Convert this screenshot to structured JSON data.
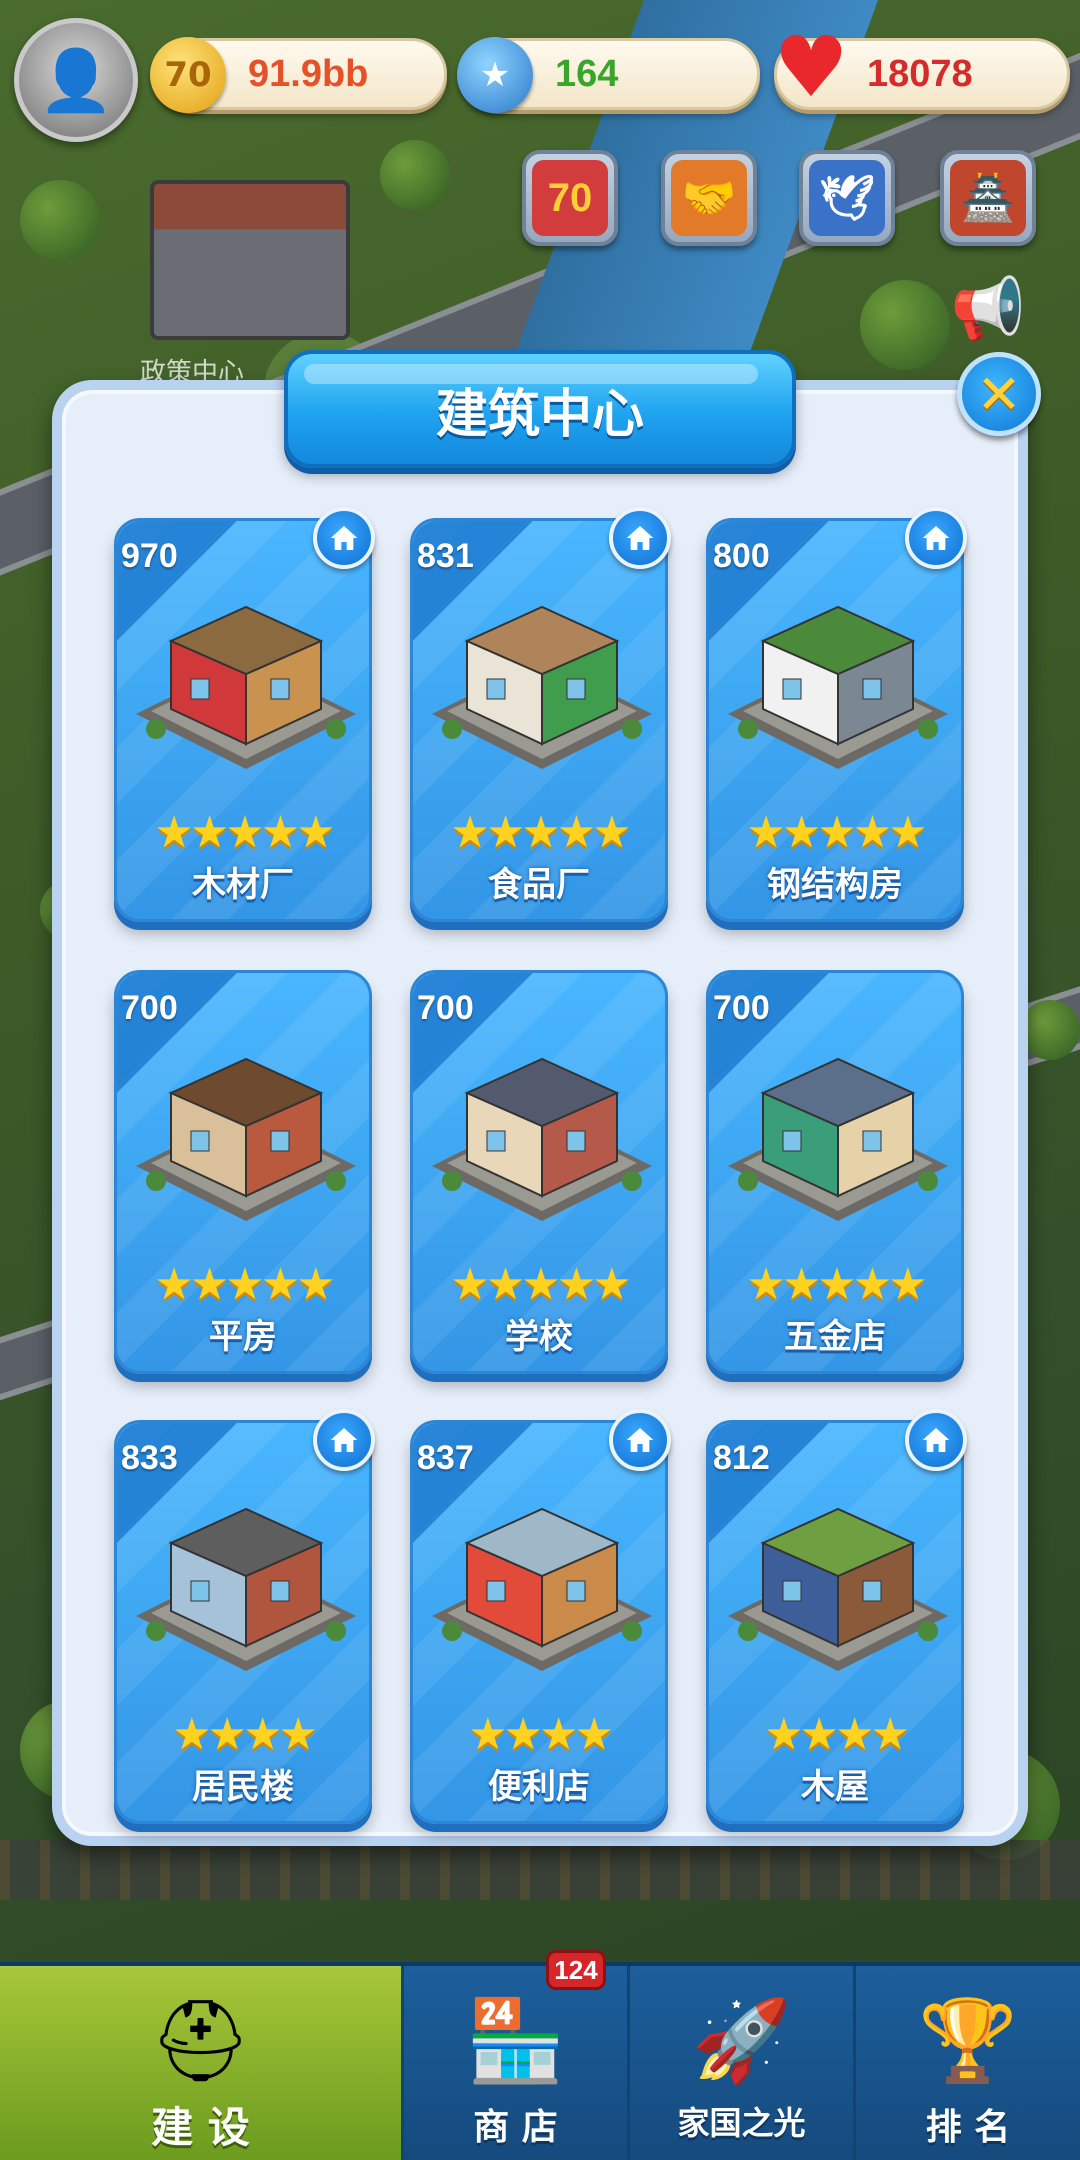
{
  "hud": {
    "coins": "91.9bb",
    "coin_icon_text": "70",
    "stars": "164",
    "hearts": "18078"
  },
  "top_buttons": [
    {
      "name": "70-event",
      "text": "70"
    },
    {
      "name": "trade",
      "text": ""
    },
    {
      "name": "bird-event",
      "text": ""
    },
    {
      "name": "house-event",
      "text": ""
    }
  ],
  "background": {
    "building_label": "政策中心"
  },
  "modal": {
    "title": "建筑中心",
    "close_symbol": "✕"
  },
  "cards": [
    {
      "score": "970",
      "name": "木材厂",
      "stars": 5,
      "home": true,
      "colors": [
        "#c9924e",
        "#d0383a",
        "#8a6a3e"
      ]
    },
    {
      "score": "831",
      "name": "食品厂",
      "stars": 5,
      "home": true,
      "colors": [
        "#3f9d4d",
        "#e9e4d6",
        "#b0845a"
      ]
    },
    {
      "score": "800",
      "name": "钢结构房",
      "stars": 5,
      "home": true,
      "colors": [
        "#7c8794",
        "#f1f1f1",
        "#4a8a3a"
      ]
    },
    {
      "score": "700",
      "name": "平房",
      "stars": 5,
      "home": false,
      "colors": [
        "#b95a3e",
        "#d9c09a",
        "#6e4a2e"
      ]
    },
    {
      "score": "700",
      "name": "学校",
      "stars": 5,
      "home": false,
      "colors": [
        "#b55a4a",
        "#e8d7b8",
        "#545a6e"
      ]
    },
    {
      "score": "700",
      "name": "五金店",
      "stars": 5,
      "home": false,
      "colors": [
        "#e6d2a8",
        "#3a9e7a",
        "#5b6e8a"
      ]
    },
    {
      "score": "833",
      "name": "居民楼",
      "stars": 4,
      "home": true,
      "colors": [
        "#b0553e",
        "#a6c2d8",
        "#5e5e5e"
      ]
    },
    {
      "score": "837",
      "name": "便利店",
      "stars": 4,
      "home": true,
      "colors": [
        "#c98a4a",
        "#e24b3a",
        "#9fb8c8"
      ]
    },
    {
      "score": "812",
      "name": "木屋",
      "stars": 4,
      "home": true,
      "colors": [
        "#8a5a3a",
        "#3e5e9a",
        "#6ea042"
      ]
    }
  ],
  "nav": {
    "items": [
      {
        "label": "建 设",
        "icon": "hard-hat",
        "glyph": "⛑"
      },
      {
        "label": "商 店",
        "icon": "shop",
        "glyph": "🏪"
      },
      {
        "label": "家国之光",
        "icon": "rocket",
        "glyph": "🚀"
      },
      {
        "label": "排 名",
        "icon": "ranking",
        "glyph": "🏆"
      }
    ],
    "shop_badge": "124"
  }
}
